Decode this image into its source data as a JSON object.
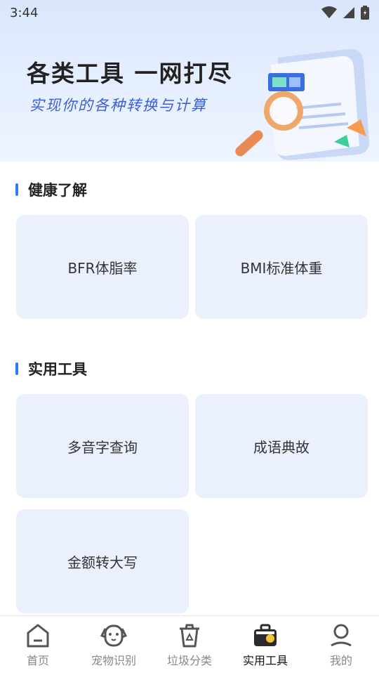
{
  "status_bar": {
    "time": "3:44"
  },
  "banner": {
    "title": "各类工具 一网打尽",
    "subtitle": "实现你的各种转换与计算"
  },
  "sections": [
    {
      "title": "健康了解",
      "items": [
        "BFR体脂率",
        "BMI标准体重"
      ]
    },
    {
      "title": "实用工具",
      "items": [
        "多音字查询",
        "成语典故",
        "金额转大写"
      ]
    }
  ],
  "tabs": [
    {
      "label": "首页",
      "icon": "home-icon",
      "active": false
    },
    {
      "label": "宠物识别",
      "icon": "pet-icon",
      "active": false
    },
    {
      "label": "垃圾分类",
      "icon": "trash-icon",
      "active": false
    },
    {
      "label": "实用工具",
      "icon": "toolbox-icon",
      "active": true
    },
    {
      "label": "我的",
      "icon": "profile-icon",
      "active": false
    }
  ],
  "colors": {
    "accent": "#2f7cf6",
    "card_bg": "#eaf1fd",
    "banner_bg": "#e3edfc"
  }
}
